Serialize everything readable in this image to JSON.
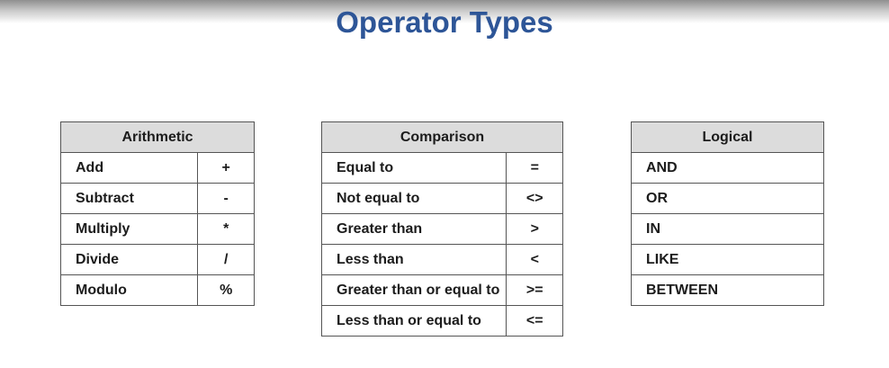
{
  "title": "Operator Types",
  "arithmetic": {
    "header": "Arithmetic",
    "rows": [
      {
        "name": "Add",
        "symbol": "+"
      },
      {
        "name": "Subtract",
        "symbol": "-"
      },
      {
        "name": "Multiply",
        "symbol": "*"
      },
      {
        "name": "Divide",
        "symbol": "/"
      },
      {
        "name": "Modulo",
        "symbol": "%"
      }
    ]
  },
  "comparison": {
    "header": "Comparison",
    "rows": [
      {
        "name": "Equal to",
        "symbol": "="
      },
      {
        "name": "Not equal to",
        "symbol": "<>"
      },
      {
        "name": "Greater than",
        "symbol": ">"
      },
      {
        "name": "Less than",
        "symbol": "<"
      },
      {
        "name": "Greater than or equal to",
        "symbol": ">="
      },
      {
        "name": "Less than or equal to",
        "symbol": "<="
      }
    ]
  },
  "logical": {
    "header": "Logical",
    "rows": [
      {
        "name": "AND"
      },
      {
        "name": "OR"
      },
      {
        "name": "IN"
      },
      {
        "name": "LIKE"
      },
      {
        "name": "BETWEEN"
      }
    ]
  },
  "colors": {
    "title": "#2d5597",
    "header_bg": "#dcdcdc",
    "border": "#555555"
  }
}
